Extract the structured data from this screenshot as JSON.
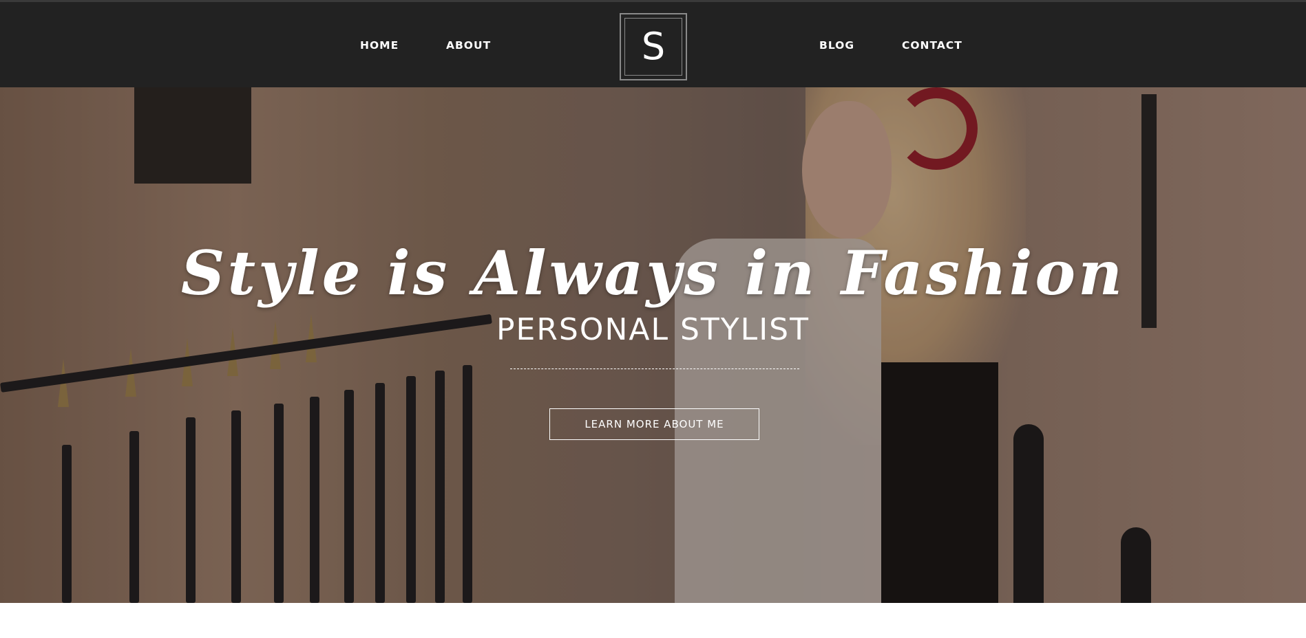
{
  "header": {
    "logo_letter": "S",
    "nav_left": [
      {
        "label": "HOME"
      },
      {
        "label": "ABOUT"
      }
    ],
    "nav_right": [
      {
        "label": "BLOG"
      },
      {
        "label": "CONTACT"
      }
    ]
  },
  "hero": {
    "title": "Style is Always in Fashion",
    "subtitle": "PERSONAL STYLIST",
    "cta_label": "LEARN MORE ABOUT ME"
  },
  "colors": {
    "header_bg": "#222222",
    "text": "#ffffff",
    "accent_headband": "#9c1c2a"
  },
  "icons": [
    "logo-monogram"
  ]
}
